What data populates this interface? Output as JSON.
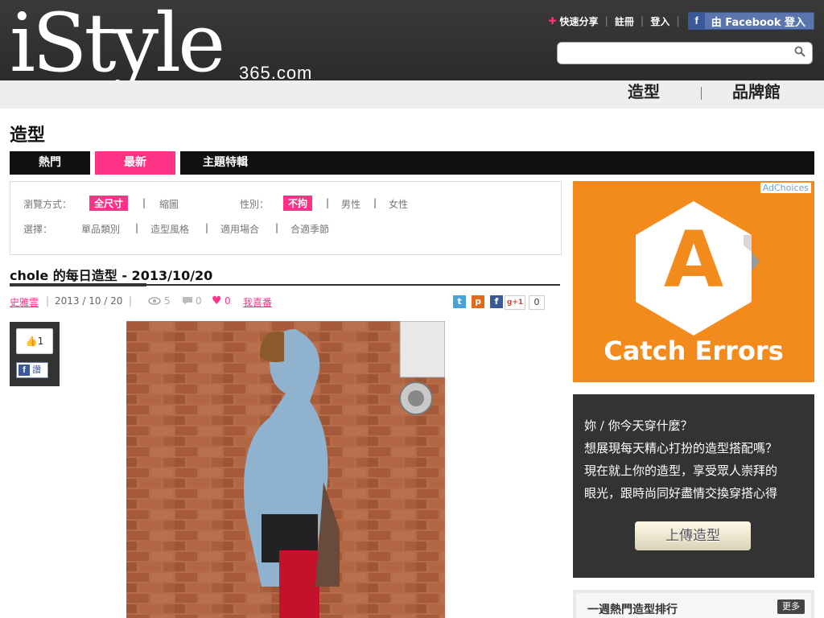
{
  "brand": {
    "logo": "iStyle",
    "domain": "365.com"
  },
  "top_links": {
    "quick_share": "快速分享",
    "register": "註冊",
    "login": "登入",
    "fb_login": "由 Facebook 登入"
  },
  "search": {
    "placeholder": ""
  },
  "main_nav": [
    {
      "label": "造型"
    },
    {
      "label": "品牌館"
    }
  ],
  "page_title": "造型",
  "tabs": [
    {
      "label": "熱門"
    },
    {
      "label": "最新",
      "active": true
    },
    {
      "label": "主題特輯"
    }
  ],
  "filters": {
    "browse_label": "瀏覽方式：",
    "browse_options": [
      "全尺寸",
      "縮圖"
    ],
    "gender_label": "性別：",
    "gender_options": [
      "不拘",
      "男性",
      "女性"
    ],
    "select_label": "選擇：",
    "select_options": [
      "單品類別",
      "造型風格",
      "適用場合",
      "合適季節"
    ]
  },
  "post": {
    "title": "chole 的每日造型 - 2013/10/20",
    "author": "史雅雲",
    "date": "2013 / 10 / 20",
    "views": "5",
    "comments": "0",
    "likes": "0",
    "like_action": "我喜番",
    "gplus_count": "0",
    "fb_like_count": "1",
    "fb_share": "讚"
  },
  "ad": {
    "choices": "AdChoices",
    "letter": "A",
    "tagline": "Catch Errors"
  },
  "upload_promo": {
    "lines": [
      "妳 / 你今天穿什麼？",
      "想展現每天精心打扮的造型搭配嗎？",
      "現在就上你的造型，享受眾人崇拜的",
      "眼光，跟時尚同好盡情交換穿搭心得"
    ],
    "button": "上傳造型"
  },
  "ranking": {
    "title": "一週熱門造型排行",
    "more": "更多"
  },
  "colors": {
    "accent": "#ff3385",
    "header": "#333333",
    "ad_orange": "#f28a1c"
  }
}
